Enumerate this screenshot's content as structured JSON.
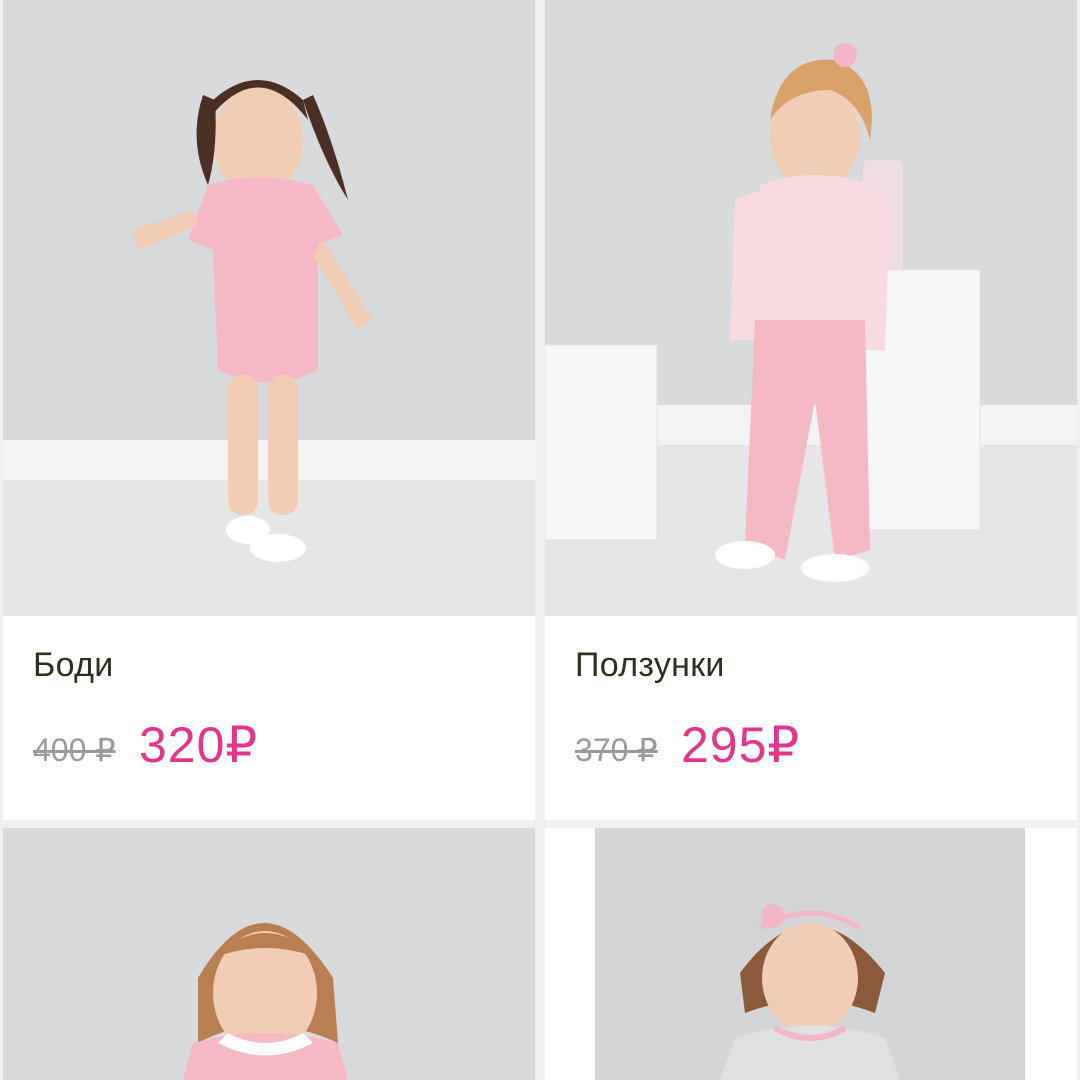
{
  "products": [
    {
      "name": "Боди",
      "old_price": "400 ₽",
      "new_price": "320₽"
    },
    {
      "name": "Ползунки",
      "old_price": "370 ₽",
      "new_price": "295₽"
    },
    {
      "name": "",
      "old_price": "",
      "new_price": ""
    },
    {
      "name": "",
      "old_price": "",
      "new_price": ""
    }
  ],
  "colors": {
    "accent_price": "#e6348a",
    "old_price": "#9a9a9a",
    "title": "#2f2f1e",
    "background": "#eef0f2"
  }
}
